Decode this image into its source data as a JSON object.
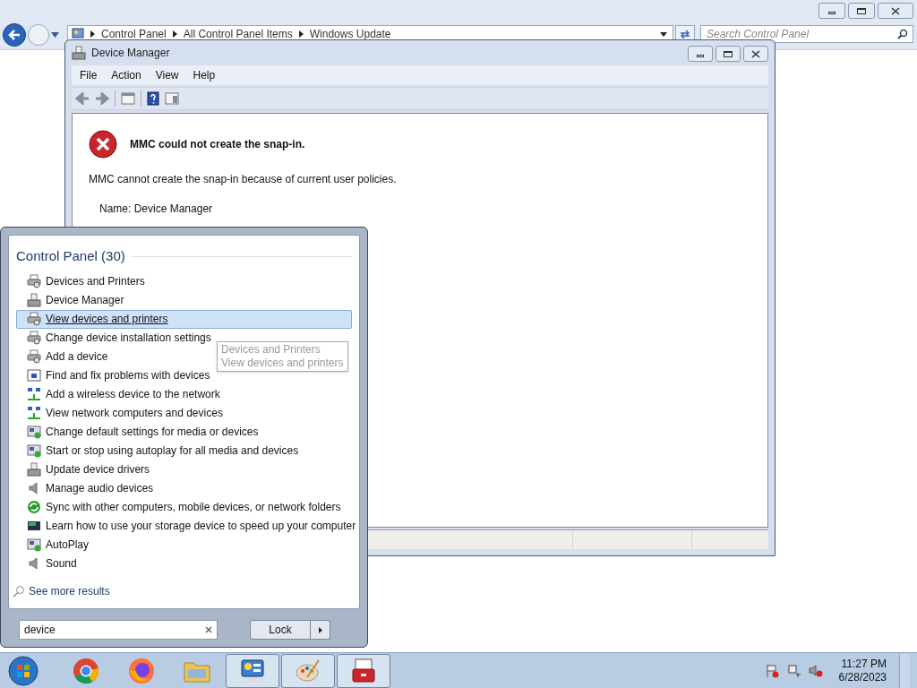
{
  "explorer": {
    "breadcrumbs": [
      "Control Panel",
      "All Control Panel Items",
      "Windows Update"
    ],
    "search": {
      "placeholder": "Search Control Panel"
    }
  },
  "device_manager": {
    "title": "Device Manager",
    "menu": [
      "File",
      "Action",
      "View",
      "Help"
    ],
    "error": {
      "title": "MMC could not create the snap-in.",
      "message": "MMC cannot create the snap-in because of current user policies.",
      "detail": "Name: Device Manager"
    }
  },
  "start_menu": {
    "group_title": "Control Panel (30)",
    "items": [
      {
        "label": "Devices and Printers",
        "kind": "printer",
        "selected": false
      },
      {
        "label": "Device Manager",
        "kind": "device",
        "selected": false
      },
      {
        "label": "View devices and printers",
        "kind": "printer",
        "selected": true
      },
      {
        "label": "Change device installation settings",
        "kind": "printer",
        "selected": false
      },
      {
        "label": "Add a device",
        "kind": "printer",
        "selected": false
      },
      {
        "label": "Find and fix problems with devices",
        "kind": "monitor",
        "selected": false
      },
      {
        "label": "Add a wireless device to the network",
        "kind": "network",
        "selected": false
      },
      {
        "label": "View network computers and devices",
        "kind": "network",
        "selected": false
      },
      {
        "label": "Change default settings for media or devices",
        "kind": "media",
        "selected": false
      },
      {
        "label": "Start or stop using autoplay for all media and devices",
        "kind": "media",
        "selected": false
      },
      {
        "label": "Update device drivers",
        "kind": "device",
        "selected": false
      },
      {
        "label": "Manage audio devices",
        "kind": "speaker",
        "selected": false
      },
      {
        "label": "Sync with other computers, mobile devices, or network folders",
        "kind": "sync",
        "selected": false
      },
      {
        "label": "Learn how to use your storage device to speed up your computer",
        "kind": "storage",
        "selected": false
      },
      {
        "label": "AutoPlay",
        "kind": "media",
        "selected": false
      },
      {
        "label": "Sound",
        "kind": "speaker",
        "selected": false
      }
    ],
    "tooltip": [
      "Devices and Printers",
      "View devices and printers"
    ],
    "see_more": "See more results",
    "search": {
      "value": "device"
    },
    "power_button": "Lock"
  },
  "taskbar": {
    "apps": [
      {
        "kind": "chrome",
        "open": false
      },
      {
        "kind": "firefox",
        "open": false
      },
      {
        "kind": "folder",
        "open": false
      },
      {
        "kind": "control-panel",
        "open": true
      },
      {
        "kind": "paint",
        "open": true
      },
      {
        "kind": "toolbox",
        "open": true
      }
    ],
    "clock": {
      "time": "11:27 PM",
      "date": "6/28/2023"
    }
  }
}
